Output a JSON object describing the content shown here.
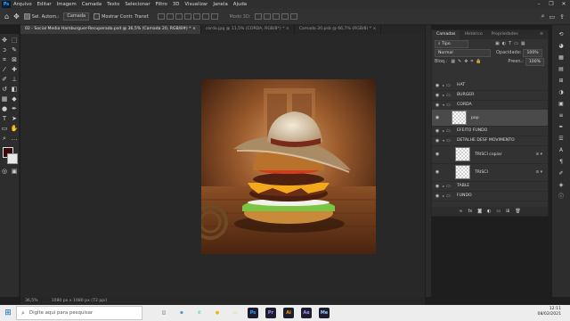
{
  "menubar": {
    "logo": "Ps",
    "items": [
      "Arquivo",
      "Editar",
      "Imagem",
      "Camada",
      "Texto",
      "Selecionar",
      "Filtro",
      "3D",
      "Visualizar",
      "Janela",
      "Ajuda"
    ],
    "window_controls": [
      "–",
      "❐",
      "✕"
    ]
  },
  "options": {
    "auto_select_label": "Sel. Autom.:",
    "auto_select_target": "Camada",
    "transform_label": "Mostrar Contr. Transf.",
    "mode_3d": "Modo 3D:"
  },
  "tabs": [
    {
      "label": "02 - Social Media Hamburguer-Recuperado.psd @ 36,5% (Camada 20, RGB/8#) *",
      "active": true
    },
    {
      "label": "corda.jpg @ 11,5% (CORDA, RGB/8*) *",
      "active": false
    },
    {
      "label": "Camada 20.psb @ 66,7% (RGB/8) *",
      "active": false
    }
  ],
  "status": {
    "zoom": "36,5%",
    "doc_size": "1080 px x 1080 px (72 ppi)"
  },
  "layers_panel": {
    "tabs": [
      {
        "label": "Camadas",
        "active": true
      },
      {
        "label": "Histórico",
        "active": false
      },
      {
        "label": "Propriedades",
        "active": false
      }
    ],
    "filter_kind": "Tipo",
    "blend_mode": "Normal",
    "opacity_label": "Opacidade:",
    "opacity_value": "100%",
    "lock_label": "Bloq.:",
    "fill_label": "Preen.:",
    "fill_value": "100%",
    "layers": [
      {
        "name": "HAT",
        "kind": "group",
        "selected": false
      },
      {
        "name": "BURGER",
        "kind": "group",
        "selected": false
      },
      {
        "name": "CORDA",
        "kind": "group",
        "selected": false
      },
      {
        "name": "pop",
        "kind": "layer",
        "selected": true
      },
      {
        "name": "EFEITO FUNDO",
        "kind": "group",
        "selected": false
      },
      {
        "name": "DETALHE DESF MOVIMENTO",
        "kind": "group",
        "selected": false
      },
      {
        "name": "TRISCI copiar",
        "kind": "layer",
        "selected": false
      },
      {
        "name": "TRISCI",
        "kind": "layer",
        "selected": false
      },
      {
        "name": "TABLE",
        "kind": "group",
        "selected": false
      },
      {
        "name": "FUNDO",
        "kind": "group",
        "selected": false
      }
    ]
  },
  "taskbar": {
    "search_placeholder": "Digite aqui para pesquisar",
    "apps": [
      {
        "icon": "task-view-icon",
        "color": "#333333",
        "glyph": "◫"
      },
      {
        "icon": "edge-icon",
        "color": "#0f7bd8",
        "glyph": "e"
      },
      {
        "icon": "whatsapp-icon",
        "color": "#25d366",
        "glyph": "✆"
      },
      {
        "icon": "chrome-icon",
        "color": "#f4b400",
        "glyph": "●"
      },
      {
        "icon": "explorer-icon",
        "color": "#f2c14e",
        "glyph": "▭"
      },
      {
        "icon": "photoshop-icon",
        "color": "#31a8ff",
        "glyph": "Ps"
      },
      {
        "icon": "premiere-icon",
        "color": "#9999ff",
        "glyph": "Pr"
      },
      {
        "icon": "illustrator-icon",
        "color": "#ff9a00",
        "glyph": "Ai"
      },
      {
        "icon": "after-effects-icon",
        "color": "#9999ff",
        "glyph": "Ae"
      },
      {
        "icon": "media-encoder-icon",
        "color": "#8fd3ff",
        "glyph": "Me"
      }
    ],
    "time": "12:11",
    "date": "08/02/2021"
  }
}
